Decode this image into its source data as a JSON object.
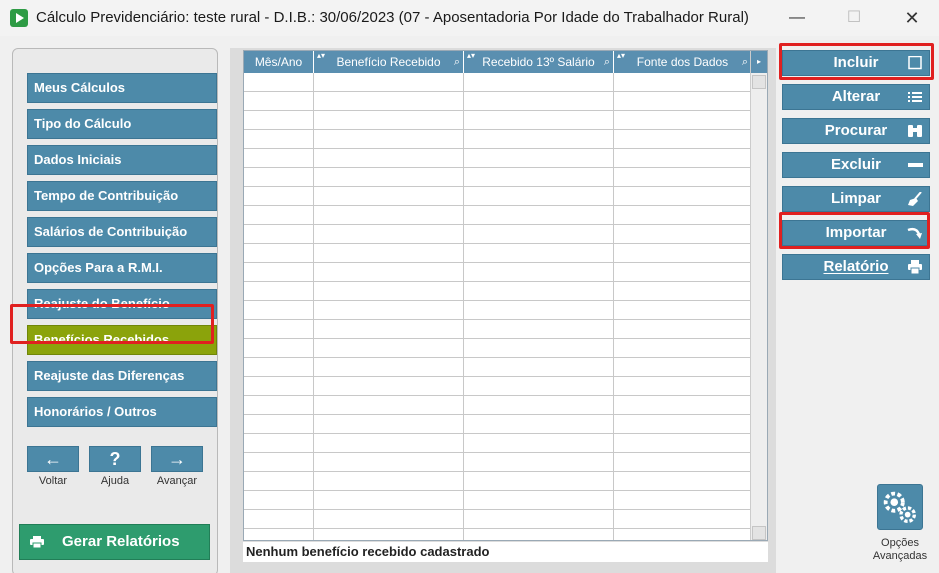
{
  "window": {
    "title": "Cálculo Previdenciário: teste rural - D.I.B.: 30/06/2023 (07 - Aposentadoria Por Idade do Trabalhador Rural)",
    "minimize_glyph": "—",
    "maximize_glyph": "☐",
    "close_glyph": "✕"
  },
  "sidebar": {
    "items": [
      {
        "label": "Meus Cálculos"
      },
      {
        "label": "Tipo do Cálculo"
      },
      {
        "label": "Dados Iniciais"
      },
      {
        "label": "Tempo de Contribuição"
      },
      {
        "label": "Salários de Contribuição"
      },
      {
        "label": "Opções Para a R.M.I."
      },
      {
        "label": "Reajuste do Benefício"
      },
      {
        "label": "Benefícios Recebidos",
        "active": true
      },
      {
        "label": "Reajuste das Diferenças"
      },
      {
        "label": "Honorários / Outros"
      }
    ],
    "nav": {
      "back_glyph": "←",
      "back_label": "Voltar",
      "help_glyph": "?",
      "help_label": "Ajuda",
      "forward_glyph": "→",
      "forward_label": "Avançar"
    },
    "reports_button": {
      "label": "Gerar Relatórios",
      "icon": "printer-icon"
    }
  },
  "grid": {
    "columns": [
      {
        "label": "Mês/Ano"
      },
      {
        "label": "Benefício Recebido"
      },
      {
        "label": "Recebido 13º Salário"
      },
      {
        "label": "Fonte dos Dados"
      }
    ],
    "sort_glyph": "▴▾",
    "search_glyph": "⌕",
    "rows": [],
    "status": "Nenhum benefício recebido cadastrado"
  },
  "actions": [
    {
      "label": "Incluir",
      "icon": "square-icon"
    },
    {
      "label": "Alterar",
      "icon": "list-icon"
    },
    {
      "label": "Procurar",
      "icon": "binoculars-icon"
    },
    {
      "label": "Excluir",
      "icon": "minus-icon"
    },
    {
      "label": "Limpar",
      "icon": "broom-icon"
    },
    {
      "label": "Importar",
      "icon": "import-arrow-icon"
    },
    {
      "label": "Relatório",
      "icon": "printer-icon"
    }
  ],
  "advanced_options": {
    "label": "Opções Avançadas",
    "icon": "gears-icon"
  },
  "colors": {
    "button_blue": "#4d8aa9",
    "active_green": "#8ba30b",
    "reports_green": "#2e9c6e",
    "highlight_red": "#e02020"
  }
}
